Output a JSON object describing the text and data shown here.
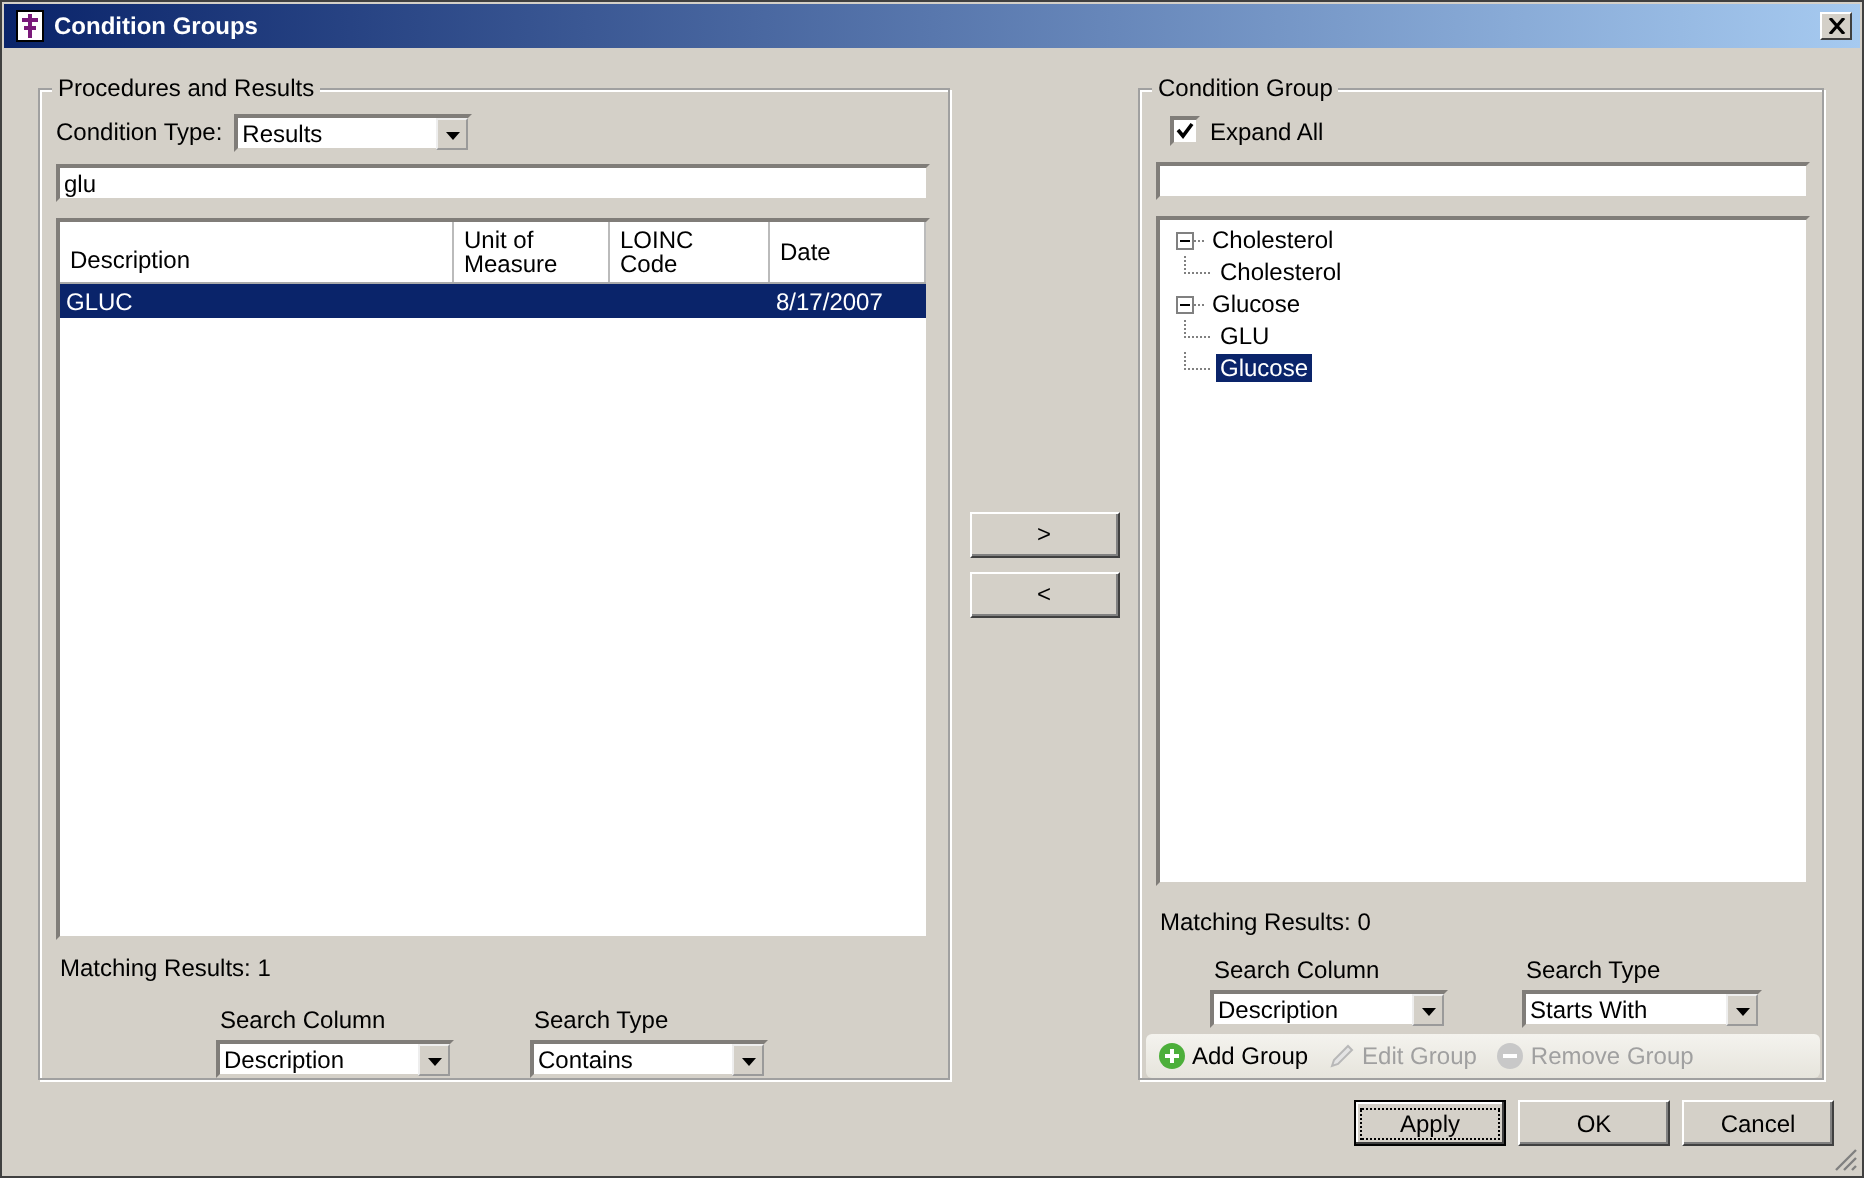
{
  "window": {
    "title": "Condition Groups"
  },
  "left_panel": {
    "title": "Procedures and Results",
    "condition_type_label": "Condition Type:",
    "condition_type_value": "Results",
    "search_value": "glu",
    "table": {
      "columns": [
        "Description",
        "Unit of Measure",
        "LOINC Code",
        "Date"
      ],
      "rows": [
        {
          "cells": [
            "GLUC",
            "",
            "",
            "8/17/2007"
          ],
          "selected": true
        }
      ]
    },
    "matching_results": "Matching Results: 1",
    "search_column": {
      "label": "Search Column",
      "value": "Description"
    },
    "search_type": {
      "label": "Search Type",
      "value": "Contains"
    }
  },
  "move_buttons": [
    ">",
    "<"
  ],
  "right_panel": {
    "title": "Condition Group",
    "expand_all": {
      "label": "Expand All",
      "checked": true
    },
    "tree": [
      {
        "label": "Cholesterol",
        "expanded": true,
        "selected": false,
        "children": [
          {
            "label": "Cholesterol",
            "selected": false
          }
        ]
      },
      {
        "label": "Glucose",
        "expanded": true,
        "selected": false,
        "children": [
          {
            "label": "GLU",
            "selected": false
          },
          {
            "label": "Glucose",
            "selected": true
          }
        ]
      }
    ],
    "matching_results": "Matching Results: 0",
    "search_column": {
      "label": "Search Column",
      "value": "Description"
    },
    "search_type": {
      "label": "Search Type",
      "value": "Starts With"
    },
    "toolbar": [
      {
        "kind": "add",
        "label": "Add Group",
        "disabled": false
      },
      {
        "kind": "edit",
        "label": "Edit Group",
        "disabled": true
      },
      {
        "kind": "remove",
        "label": "Remove Group",
        "disabled": true
      }
    ]
  },
  "footer_buttons": [
    {
      "label": "Apply",
      "focused": true
    },
    {
      "label": "OK",
      "focused": false
    },
    {
      "label": "Cancel",
      "focused": false
    }
  ]
}
